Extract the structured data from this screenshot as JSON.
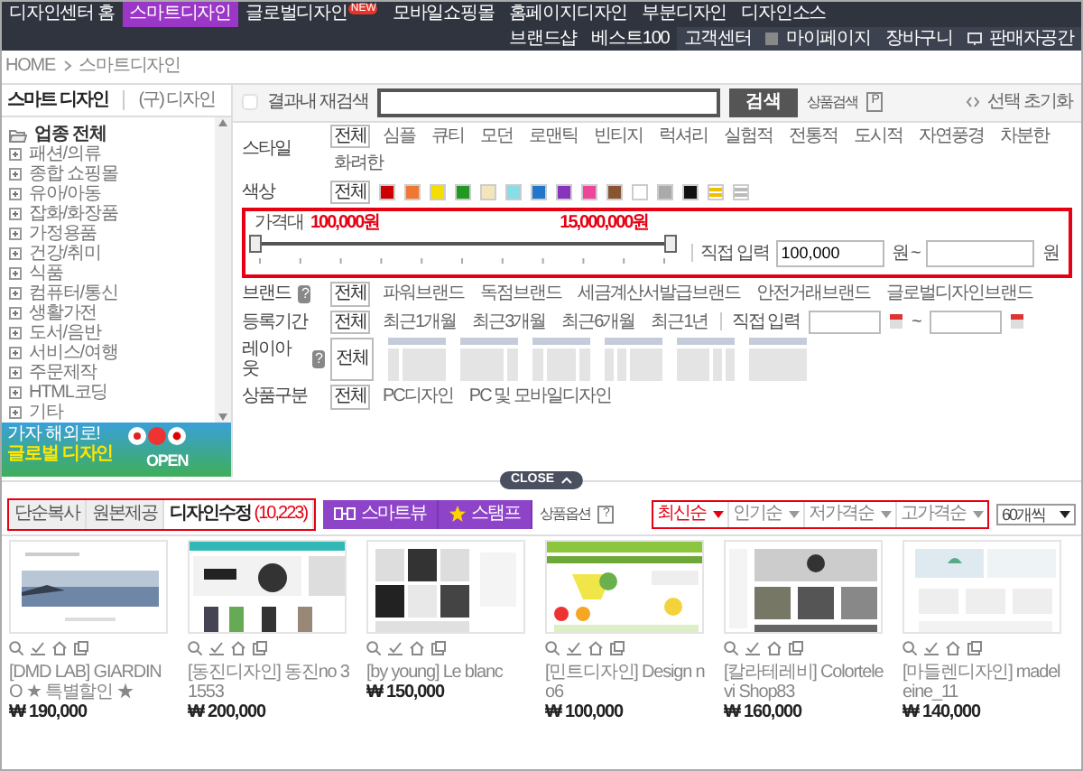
{
  "nav": {
    "items": [
      {
        "label": "디자인센터 홈",
        "selected": false
      },
      {
        "label": "스마트디자인",
        "selected": true
      },
      {
        "label": "글로벌디자인",
        "selected": false,
        "badge": "NEW"
      },
      {
        "label": "모바일쇼핑몰",
        "selected": false
      },
      {
        "label": "홈페이지디자인",
        "selected": false
      },
      {
        "label": "부분디자인",
        "selected": false
      },
      {
        "label": "디자인소스",
        "selected": false
      }
    ],
    "shop": [
      {
        "label": "브랜드샵",
        "selected": false
      },
      {
        "label": "베스트100",
        "selected": false
      }
    ],
    "utility": [
      {
        "label": "고객센터",
        "kind": "text"
      },
      {
        "label": "마이페이지",
        "kind": "grid"
      },
      {
        "label": "장바구니",
        "kind": "text"
      },
      {
        "label": "판매자공간",
        "kind": "monitor"
      }
    ]
  },
  "breadcrumb": [
    {
      "label": "HOME"
    },
    {
      "label": "스마트디자인"
    }
  ],
  "sidebar": {
    "tabs": [
      {
        "label": "스마트 디자인",
        "selected": true
      },
      {
        "label": "(구) 디자인",
        "selected": false
      }
    ],
    "tree": {
      "label": "업종 전체",
      "expanded": true,
      "children": [
        {
          "label": "패션/의류",
          "expanded": false
        },
        {
          "label": "종합 쇼핑몰",
          "expanded": false
        },
        {
          "label": "유아/아동",
          "expanded": false
        },
        {
          "label": "잡화/화장품",
          "expanded": false
        },
        {
          "label": "가정용품",
          "expanded": false
        },
        {
          "label": "건강/취미",
          "expanded": false
        },
        {
          "label": "식품",
          "expanded": false
        },
        {
          "label": "컴퓨터/통신",
          "expanded": false
        },
        {
          "label": "생활가전",
          "expanded": false
        },
        {
          "label": "도서/음반",
          "expanded": false
        },
        {
          "label": "서비스/여행",
          "expanded": false
        },
        {
          "label": "주문제작",
          "expanded": false
        },
        {
          "label": "HTML코딩",
          "expanded": false
        },
        {
          "label": "기타",
          "expanded": false
        }
      ]
    },
    "banner": {
      "line_1": "가자 해외로!",
      "line_2": "글로벌 디자인",
      "button": "OPEN"
    }
  },
  "search": {
    "recheck": {
      "label": "결과내 재검색",
      "checked": false
    },
    "button": "검색",
    "advanced": {
      "label": "상품검색",
      "mark": "P"
    },
    "reset": "선택 초기화"
  },
  "filters": {
    "style": {
      "label": "스타일",
      "options": [
        {
          "label": "전체",
          "selected": true
        },
        {
          "label": "심플",
          "selected": false
        },
        {
          "label": "큐티",
          "selected": false
        },
        {
          "label": "모던",
          "selected": false
        },
        {
          "label": "로맨틱",
          "selected": false
        },
        {
          "label": "빈티지",
          "selected": false
        },
        {
          "label": "럭셔리",
          "selected": false
        },
        {
          "label": "실험적",
          "selected": false
        },
        {
          "label": "전통적",
          "selected": false
        },
        {
          "label": "도시적",
          "selected": false
        },
        {
          "label": "자연풍경",
          "selected": false
        },
        {
          "label": "차분한",
          "selected": false
        },
        {
          "label": "화려한",
          "selected": false
        }
      ]
    },
    "color": {
      "label": "색상",
      "all": {
        "label": "전체",
        "selected": true
      },
      "swatches": [
        {
          "color": "#cc0000",
          "kind": "solid"
        },
        {
          "color": "#ee7733",
          "kind": "solid"
        },
        {
          "color": "#f5dd00",
          "kind": "solid"
        },
        {
          "color": "#229922",
          "kind": "solid"
        },
        {
          "color": "#f3e6bd",
          "kind": "solid"
        },
        {
          "color": "#88dde8",
          "kind": "solid"
        },
        {
          "color": "#2277cc",
          "kind": "solid"
        },
        {
          "color": "#8833bb",
          "kind": "solid"
        },
        {
          "color": "#ee4499",
          "kind": "solid"
        },
        {
          "color": "#885533",
          "kind": "solid"
        },
        {
          "color": "#ffffff",
          "kind": "solid"
        },
        {
          "color": "#aaaaaa",
          "kind": "solid"
        },
        {
          "color": "#111111",
          "kind": "solid"
        },
        {
          "color": "#f0c000",
          "kind": "striped"
        },
        {
          "color": "#bbbbbb",
          "kind": "striped"
        }
      ]
    },
    "price": {
      "label": "가격대",
      "min": "100,000원",
      "max": "15,000,000원",
      "thumbs": [
        {
          "level": 0
        },
        {
          "level": 1
        }
      ],
      "direct_label": "직접 입력",
      "from_value": "100,000",
      "from_unit": "원 ~",
      "to_unit": "원"
    },
    "brand": {
      "label": "브랜드",
      "help": "?",
      "options": [
        {
          "label": "전체",
          "selected": true
        },
        {
          "label": "파워브랜드",
          "selected": false
        },
        {
          "label": "독점브랜드",
          "selected": false
        },
        {
          "label": "세금계산서발급브랜드",
          "selected": false
        },
        {
          "label": "안전거래브랜드",
          "selected": false
        },
        {
          "label": "글로벌디자인브랜드",
          "selected": false
        }
      ]
    },
    "period": {
      "label": "등록기간",
      "options": [
        {
          "label": "전체",
          "selected": true
        },
        {
          "label": "최근1개월",
          "selected": false
        },
        {
          "label": "최근3개월",
          "selected": false
        },
        {
          "label": "최근6개월",
          "selected": false
        },
        {
          "label": "최근1년",
          "selected": false
        }
      ],
      "direct_label": "직접 입력",
      "tilde": "~"
    },
    "layout": {
      "label": "레이아웃",
      "help": "?",
      "all": {
        "label": "전체",
        "selected": true
      },
      "layouts": [
        {
          "kind": "left-sidebar",
          "selected": false
        },
        {
          "kind": "right-sidebar",
          "selected": false
        },
        {
          "kind": "both-sidebars",
          "selected": false
        },
        {
          "kind": "two-left",
          "selected": false
        },
        {
          "kind": "two-right",
          "selected": false
        },
        {
          "kind": "single",
          "selected": false
        }
      ]
    },
    "product_type": {
      "label": "상품구분",
      "options": [
        {
          "label": "전체",
          "selected": true
        },
        {
          "label": "PC디자인",
          "selected": false
        },
        {
          "label": "PC 및 모바일디자인",
          "selected": false
        }
      ]
    }
  },
  "close_button": "CLOSE",
  "toolbar": {
    "tabs": [
      {
        "label": "단순복사",
        "selected": false
      },
      {
        "label": "원본제공",
        "selected": false
      },
      {
        "label": "디자인수정",
        "selected": true,
        "count": "(10,223)"
      }
    ],
    "views": [
      {
        "label": "스마트뷰",
        "kind": "view"
      },
      {
        "label": "스탬프",
        "kind": "star"
      }
    ],
    "options": {
      "label": "상품옵션",
      "mark": "?"
    },
    "sorts": [
      {
        "label": "최신순",
        "selected": true
      },
      {
        "label": "인기순",
        "selected": false
      },
      {
        "label": "저가격순",
        "selected": false
      },
      {
        "label": "고가격순",
        "selected": false
      }
    ],
    "per_page": "60개씩"
  },
  "products": [
    {
      "title": "[DMD LAB] GIARDINO ★ 특별할인 ★",
      "price": "₩ 190,000"
    },
    {
      "title": "[동진디자인] 동진no 31553",
      "price": "₩ 200,000"
    },
    {
      "title": "[by young] Le blanc",
      "price": "₩ 150,000"
    },
    {
      "title": "[민트디자인] Design no6",
      "price": "₩ 100,000"
    },
    {
      "title": "[칼라테레비] Colortelevi Shop83",
      "price": "₩ 160,000"
    },
    {
      "title": "[마들렌디자인] madeleine_11",
      "price": "₩ 140,000"
    }
  ]
}
